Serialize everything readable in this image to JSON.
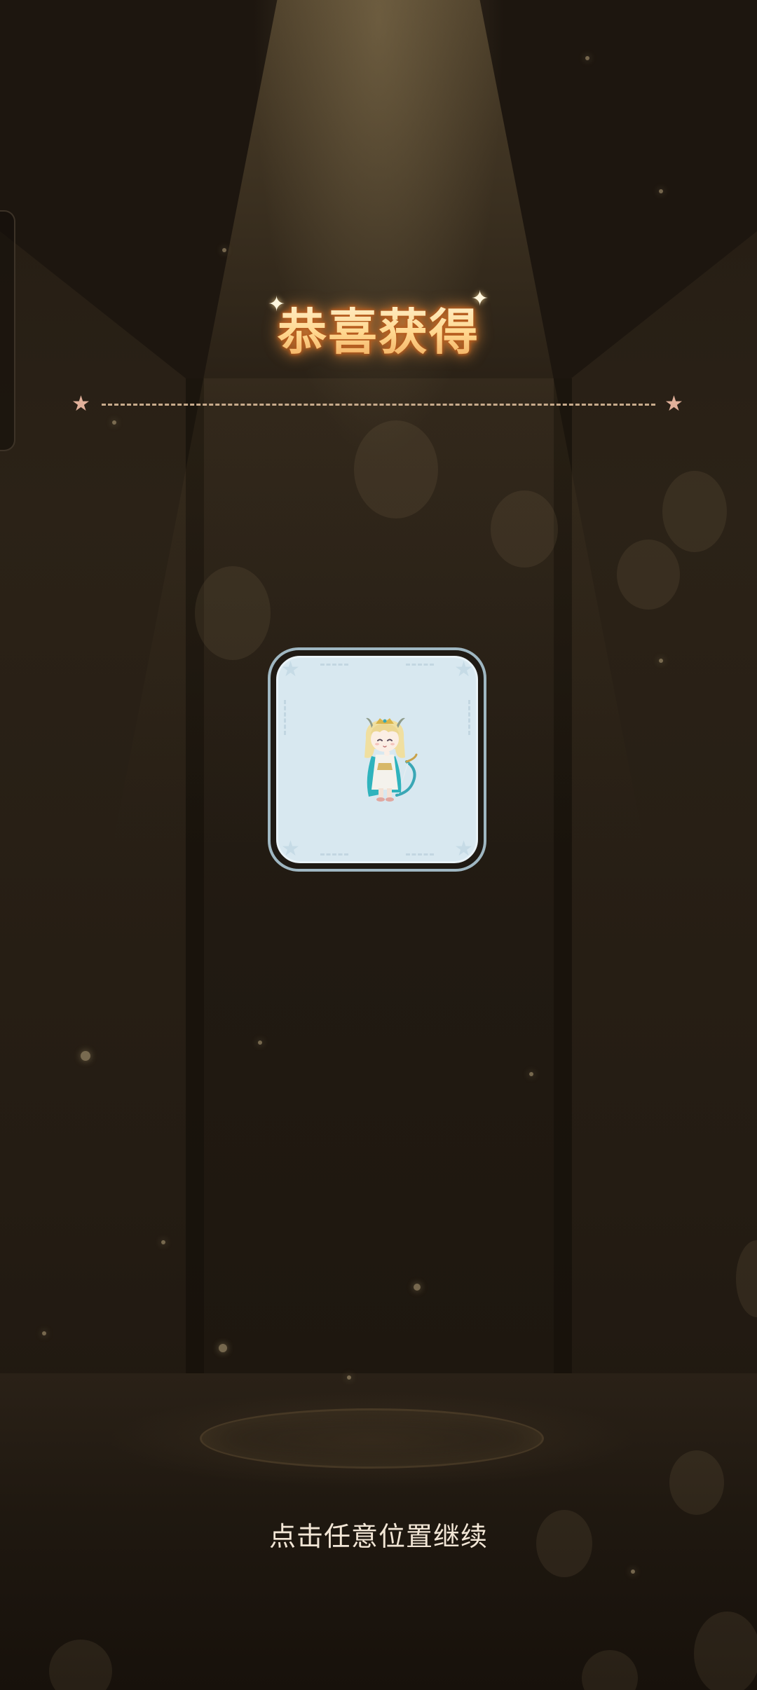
{
  "dialog": {
    "title": "恭喜获得",
    "continue_hint": "点击任意位置继续"
  },
  "reward": {
    "item_type": "character-avatar",
    "icon": "chibi-character-with-bow-icon",
    "card_background_color": "#d8e8f0",
    "card_border_color": "#9fb7c2"
  },
  "colors": {
    "background": "#1d160f",
    "title_fill": "#ffd890",
    "title_glow": "#e08c3c",
    "divider": "#c8ab8c",
    "divider_star": "#e1b09a",
    "hint_text": "#f2e6d6"
  },
  "icons": {
    "title_star_left": "sparkle-star-icon",
    "title_star_right": "sparkle-star-icon",
    "divider_star_left": "star-icon",
    "divider_star_right": "star-icon"
  }
}
